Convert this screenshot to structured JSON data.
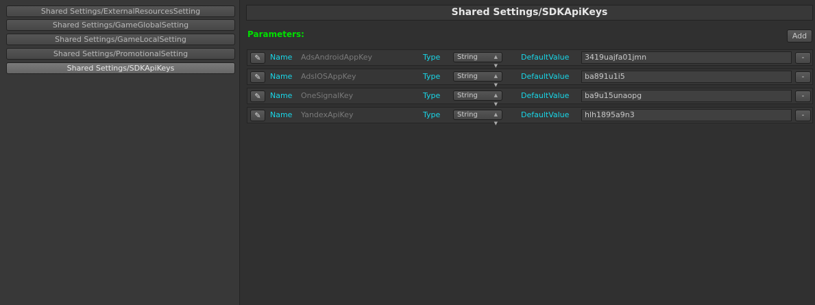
{
  "sidebar": {
    "items": [
      {
        "label": "Shared Settings/ExternalResourcesSetting",
        "selected": false
      },
      {
        "label": "Shared Settings/GameGlobalSetting",
        "selected": false
      },
      {
        "label": "Shared Settings/GameLocalSetting",
        "selected": false
      },
      {
        "label": "Shared Settings/PromotionalSetting",
        "selected": false
      },
      {
        "label": "Shared Settings/SDKApiKeys",
        "selected": true
      }
    ]
  },
  "main": {
    "title": "Shared Settings/SDKApiKeys",
    "parameters_label": "Parameters:",
    "add_label": "Add",
    "name_label": "Name",
    "type_label": "Type",
    "default_label": "DefaultValue",
    "remove_label": "-",
    "edit_icon": "pencil-icon",
    "rows": [
      {
        "name": "AdsAndroidAppKey",
        "type": "String",
        "default": "3419uajfa01jmn"
      },
      {
        "name": "AdsIOSAppKey",
        "type": "String",
        "default": "ba891u1i5"
      },
      {
        "name": "OneSignalKey",
        "type": "String",
        "default": "ba9u15unaopg"
      },
      {
        "name": "YandexApiKey",
        "type": "String",
        "default": "hlh1895a9n3"
      }
    ]
  },
  "colors": {
    "accent_cyan": "#19d7e8",
    "params_green": "#00e000"
  }
}
